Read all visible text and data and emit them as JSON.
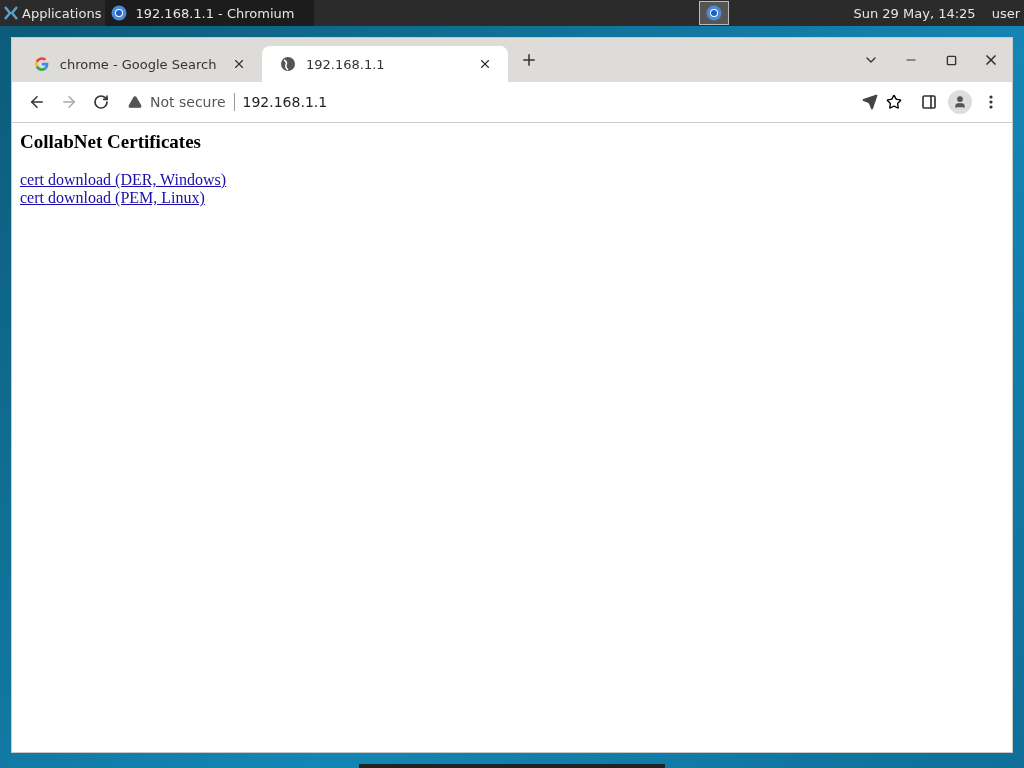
{
  "panel": {
    "menu": "Applications",
    "task": "192.168.1.1 - Chromium",
    "clock": "Sun 29 May, 14:25",
    "user": "user"
  },
  "tabs": [
    {
      "title": "chrome - Google Search",
      "kind": "google",
      "selected": false
    },
    {
      "title": "192.168.1.1",
      "kind": "globe",
      "selected": true
    }
  ],
  "address": {
    "security": "Not secure",
    "url": "192.168.1.1"
  },
  "page": {
    "heading": "CollabNet Certificates",
    "links": [
      "cert download (DER, Windows)",
      "cert download (PEM, Linux)"
    ]
  }
}
